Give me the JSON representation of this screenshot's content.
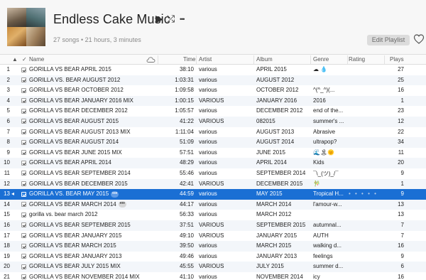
{
  "playlist": {
    "title": "Endless Cake Music",
    "subtitle": "27 songs • 21 hours, 3 minutes",
    "edit_label": "Edit Playlist",
    "play_glyph": "▶",
    "shuffle_glyph": "⤮",
    "more_glyph": "•••"
  },
  "columns": {
    "sort_arrow": "▲",
    "check": "✓",
    "name": "Name",
    "time": "Time",
    "artist": "Artist",
    "album": "Album",
    "genre": "Genre",
    "rating": "Rating",
    "plays": "Plays"
  },
  "selected_row_index": 12,
  "selection_color": "#1a6fd4",
  "rows": [
    {
      "num": "1",
      "name": "GORILLA VS BEAR APRIL 2015",
      "time": "38:10",
      "artist": "various",
      "album": "APRIL 2015",
      "genre": "☁ 💧",
      "plays": "27"
    },
    {
      "num": "2",
      "name": "GORILLA VS. BEAR AUGUST 2012",
      "time": "1:03:31",
      "artist": "various",
      "album": "AUGUST 2012",
      "genre": "",
      "plays": "25"
    },
    {
      "num": "3",
      "name": "GORILLA VS BEAR OCTOBER 2012",
      "time": "1:09:58",
      "artist": "various",
      "album": "OCTOBER 2012",
      "genre": "^(^_^)(...",
      "plays": "16"
    },
    {
      "num": "4",
      "name": "GORILLA VS BEAR JANUARY 2016 MIX",
      "time": "1:00:15",
      "artist": "VARIOUS",
      "album": "JANUARY 2016",
      "genre": "2016",
      "plays": "1"
    },
    {
      "num": "5",
      "name": "GORILLA VS BEAR DECEMBER 2012",
      "time": "1:05:57",
      "artist": "various",
      "album": "DECEMBER 2012",
      "genre": "end of the...",
      "plays": "23"
    },
    {
      "num": "6",
      "name": "GORILLA VS BEAR AUGUST 2015",
      "time": "41:22",
      "artist": "VARIOUS",
      "album": "082015",
      "genre": "summer's ...",
      "plays": "12"
    },
    {
      "num": "7",
      "name": "GORILLA VS BEAR AUGUST 2013 MIX",
      "time": "1:11:04",
      "artist": "various",
      "album": "AUGUST 2013",
      "genre": "Abrasive",
      "plays": "22"
    },
    {
      "num": "8",
      "name": "GORILLA VS BEAR AUGUST 2014",
      "time": "51:09",
      "artist": "various",
      "album": "AUGUST 2014",
      "genre": "ultrapop?",
      "plays": "34"
    },
    {
      "num": "9",
      "name": "GORILLA VS BEAR JUNE 2015 MIX",
      "time": "57:51",
      "artist": "various",
      "album": "JUNE 2015",
      "genre": "🌊🏝🌞",
      "plays": "11"
    },
    {
      "num": "10",
      "name": "GORILLA VS BEAR APRIL 2014",
      "time": "48:29",
      "artist": "various",
      "album": "APRIL 2014",
      "genre": "Kids",
      "plays": "20"
    },
    {
      "num": "11",
      "name": "GORILLA VS BEAR SEPTEMBER 2014",
      "time": "55:46",
      "artist": "various",
      "album": "SEPTEMBER 2014",
      "genre": "¯\\_(ツ)_/¯",
      "plays": "9"
    },
    {
      "num": "12",
      "name": "GORILLA VS BEAR DECEMBER 2015",
      "time": "42:41",
      "artist": "VARIOUS",
      "album": "DECEMBER 2015",
      "genre": "🎋",
      "plays": "1"
    },
    {
      "num": "13",
      "name": "GORILLA VS. BEAR MAY 2015",
      "time": "44:59",
      "artist": "various",
      "album": "MAY 2015",
      "genre": "Tropical H...",
      "plays": "9",
      "rating": "• • • • •",
      "more": "•••"
    },
    {
      "num": "14",
      "name": "GORILLA VS BEAR MARCH 2014",
      "time": "44:17",
      "artist": "various",
      "album": "MARCH 2014",
      "genre": "l'amour-w...",
      "plays": "13",
      "more": "•••"
    },
    {
      "num": "15",
      "name": "gorilla vs. bear march 2012",
      "time": "56:33",
      "artist": "various",
      "album": "MARCH 2012",
      "genre": "",
      "plays": "13"
    },
    {
      "num": "16",
      "name": "GORILLA VS BEAR SEPTEMBER 2015",
      "time": "37:51",
      "artist": "VARIOUS",
      "album": "SEPTEMBER 2015",
      "genre": "autumnal...",
      "plays": "7"
    },
    {
      "num": "17",
      "name": "GORILLA VS BEAR JANUARY 2015",
      "time": "49:10",
      "artist": "VARIOUS",
      "album": "JANUARY 2015",
      "genre": "AUTH",
      "plays": "7"
    },
    {
      "num": "18",
      "name": "GORILLA VS BEAR MARCH 2015",
      "time": "39:50",
      "artist": "various",
      "album": "MARCH 2015",
      "genre": "walking d...",
      "plays": "16"
    },
    {
      "num": "19",
      "name": "GORILLA VS BEAR JANUARY 2013",
      "time": "49:46",
      "artist": "various",
      "album": "JANUARY 2013",
      "genre": "feelings",
      "plays": "9"
    },
    {
      "num": "20",
      "name": "GORILLA VS BEAR JULY 2015 MIX",
      "time": "45:55",
      "artist": "VARIOUS",
      "album": "JULY 2015",
      "genre": "summer d...",
      "plays": "6"
    },
    {
      "num": "21",
      "name": "GORILLA VS BEAR NOVEMBER 2014 MIX",
      "time": "41:10",
      "artist": "various",
      "album": "NOVEMBER 2014",
      "genre": "icy",
      "plays": "16"
    }
  ]
}
